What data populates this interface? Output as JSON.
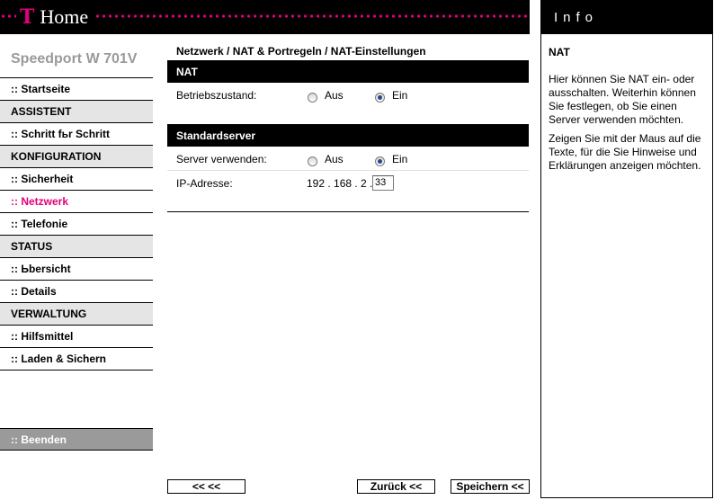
{
  "header": {
    "t_logo": "T",
    "brand": "Home"
  },
  "sidebar": {
    "product": "Speedport W 701V",
    "items": [
      {
        "type": "link",
        "label": ":: Startseite"
      },
      {
        "type": "section",
        "label": "ASSISTENT"
      },
      {
        "type": "link",
        "label": ":: Schritt fьr Schritt"
      },
      {
        "type": "section",
        "label": "KONFIGURATION"
      },
      {
        "type": "link",
        "label": ":: Sicherheit"
      },
      {
        "type": "link",
        "label": ":: Netzwerk",
        "active": true
      },
      {
        "type": "link",
        "label": ":: Telefonie"
      },
      {
        "type": "section",
        "label": "STATUS"
      },
      {
        "type": "link",
        "label": ":: Ьbersicht"
      },
      {
        "type": "link",
        "label": ":: Details"
      },
      {
        "type": "section",
        "label": "VERWALTUNG"
      },
      {
        "type": "link",
        "label": ":: Hilfsmittel"
      },
      {
        "type": "link",
        "label": ":: Laden & Sichern"
      }
    ],
    "logout": ":: Beenden"
  },
  "main": {
    "breadcrumb": "Netzwerk / NAT & Portregeln / NAT-Einstellungen",
    "nat": {
      "title": "NAT",
      "label": "Betriebszustand:",
      "option_off": "Aus",
      "option_on": "Ein",
      "selected": "Ein"
    },
    "server": {
      "title": "Standardserver",
      "label": "Server verwenden:",
      "option_off": "Aus",
      "option_on": "Ein",
      "selected": "Ein",
      "ip_label": "IP-Adresse:",
      "ip_prefix": "192 . 168 . 2 .",
      "ip_last": "33"
    }
  },
  "buttons": {
    "nav": "<<  <<",
    "back": "Zurück <<",
    "save": "Speichern <<"
  },
  "info": {
    "header": "Info",
    "title": "NAT",
    "paragraphs": [
      "Hier können Sie NAT ein- oder ausschalten. Weiterhin können Sie festlegen, ob Sie einen Server verwenden möchten.",
      "Zeigen Sie mit der Maus auf die Texte, für die Sie Hinweise und Erklärungen anzeigen möchten."
    ]
  },
  "colors": {
    "accent": "#e2007a",
    "section_bg": "#e5e5e5",
    "logout_bg": "#9a9a9a"
  }
}
